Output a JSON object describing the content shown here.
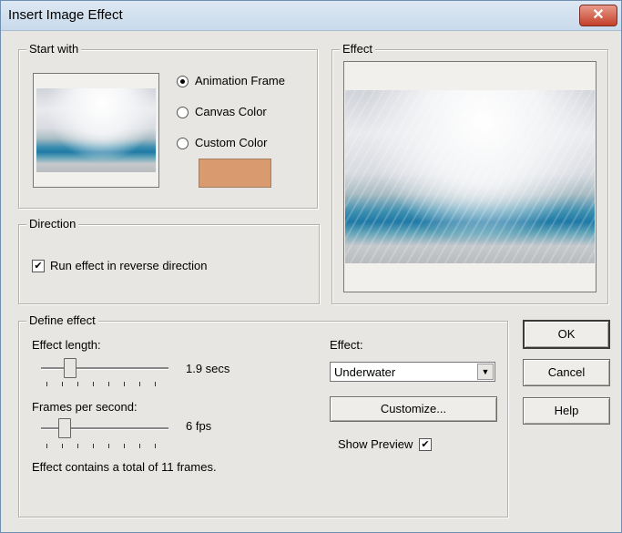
{
  "window": {
    "title": "Insert Image Effect",
    "close_glyph": "✕"
  },
  "start_with": {
    "legend": "Start with",
    "options": [
      "Animation Frame",
      "Canvas Color",
      "Custom Color"
    ],
    "selected": "Animation Frame",
    "custom_color": "#d99a70"
  },
  "effect_preview": {
    "legend": "Effect"
  },
  "direction": {
    "legend": "Direction",
    "reverse_label": "Run effect in reverse direction",
    "reverse_checked": true,
    "check_glyph": "✔"
  },
  "define_effect": {
    "legend": "Define effect",
    "length_label": "Effect length:",
    "length_value": "1.9 secs",
    "length_level": 0.2,
    "fps_label": "Frames per second:",
    "fps_value": "6 fps",
    "fps_level": 0.15,
    "effect_label": "Effect:",
    "effect_value": "Underwater",
    "dropdown_glyph": "▼",
    "customize_label": "Customize...",
    "show_preview_label": "Show Preview",
    "show_preview_checked": true,
    "total_text": "Effect contains a total of 11 frames."
  },
  "buttons": {
    "ok": "OK",
    "cancel": "Cancel",
    "help": "Help"
  }
}
